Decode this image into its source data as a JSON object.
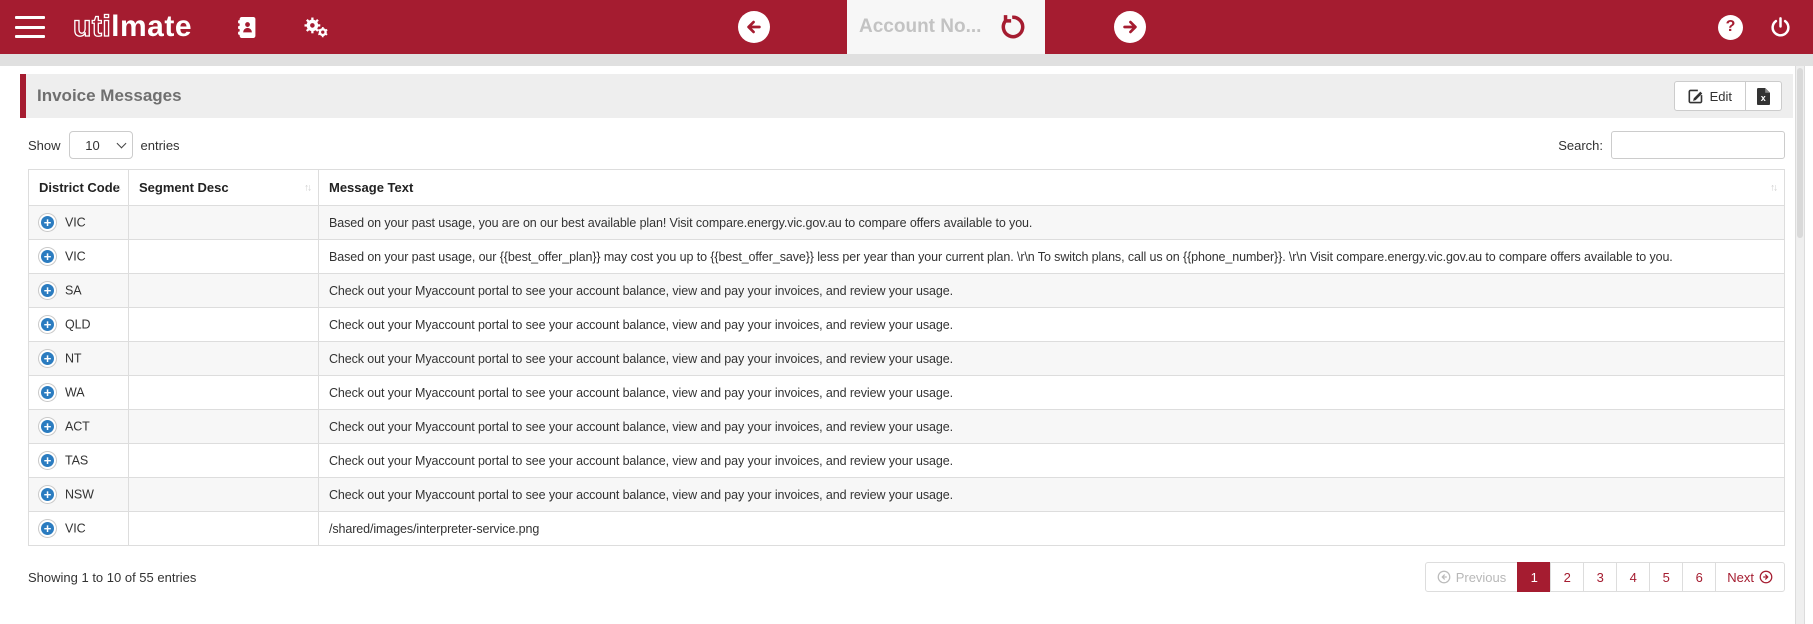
{
  "colors": {
    "navbar_bg": "#A51C30",
    "accent_red": "#A51C30",
    "plus_icon_blue": "#2B7CC0",
    "titlebar_bg": "#EEEEEE",
    "title_text": "#6F6F6F",
    "row_stripe": "#F7F7F7",
    "table_border": "#DDDDDD"
  },
  "navbar": {
    "logo": {
      "outline_part": "uti",
      "solid_part": "lmate"
    },
    "account_input": {
      "placeholder": "Account No..."
    }
  },
  "page": {
    "title": "Invoice Messages"
  },
  "toolbar": {
    "edit_label": "Edit"
  },
  "controls": {
    "show_label": "Show",
    "page_size": "10",
    "entries_label": "entries",
    "search_label": "Search:",
    "search_value": ""
  },
  "table": {
    "columns": [
      {
        "label": "District Code",
        "sortable": true
      },
      {
        "label": "Segment Desc",
        "sortable": true
      },
      {
        "label": "Message Text",
        "sortable": true
      }
    ],
    "rows": [
      {
        "district": "VIC",
        "segment": "",
        "message": "Based on your past usage, you are on our best available plan! Visit compare.energy.vic.gov.au to compare offers available to you."
      },
      {
        "district": "VIC",
        "segment": "",
        "message": "Based on your past usage, our {{best_offer_plan}} may cost you up to {{best_offer_save}} less per year than your current plan. \\r\\n To switch plans, call us on {{phone_number}}. \\r\\n Visit compare.energy.vic.gov.au to compare offers available to you."
      },
      {
        "district": "SA",
        "segment": "",
        "message": "Check out your Myaccount portal to see your account balance, view and pay your invoices, and review your usage."
      },
      {
        "district": "QLD",
        "segment": "",
        "message": "Check out your Myaccount portal to see your account balance, view and pay your invoices, and review your usage."
      },
      {
        "district": "NT",
        "segment": "",
        "message": "Check out your Myaccount portal to see your account balance, view and pay your invoices, and review your usage."
      },
      {
        "district": "WA",
        "segment": "",
        "message": "Check out your Myaccount portal to see your account balance, view and pay your invoices, and review your usage."
      },
      {
        "district": "ACT",
        "segment": "",
        "message": "Check out your Myaccount portal to see your account balance, view and pay your invoices, and review your usage."
      },
      {
        "district": "TAS",
        "segment": "",
        "message": "Check out your Myaccount portal to see your account balance, view and pay your invoices, and review your usage."
      },
      {
        "district": "NSW",
        "segment": "",
        "message": "Check out your Myaccount portal to see your account balance, view and pay your invoices, and review your usage."
      },
      {
        "district": "VIC",
        "segment": "",
        "message": "/shared/images/interpreter-service.png"
      }
    ]
  },
  "footer": {
    "summary": "Showing 1 to 10 of 55 entries",
    "pagination": {
      "previous_label": "Previous",
      "pages": [
        "1",
        "2",
        "3",
        "4",
        "5",
        "6"
      ],
      "active_page": "1",
      "next_label": "Next"
    }
  }
}
